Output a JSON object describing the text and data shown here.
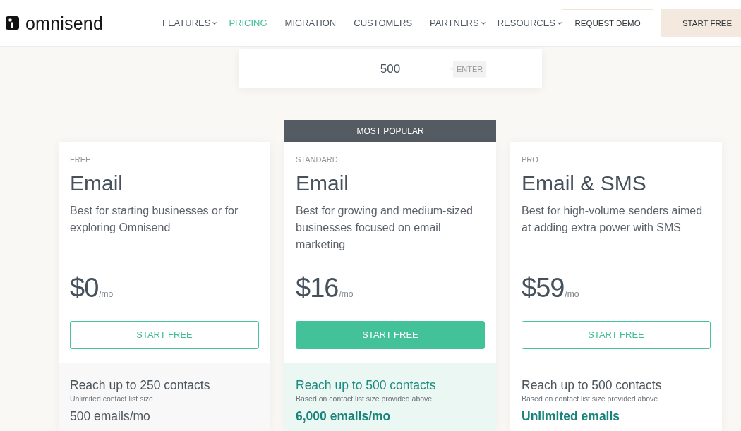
{
  "header": {
    "logo": {
      "text": "omnisend"
    },
    "nav": [
      {
        "label": "FEATURES",
        "selected": false,
        "has_menu": true
      },
      {
        "label": "PRICING",
        "selected": true,
        "has_menu": false
      },
      {
        "label": "MIGRATION",
        "selected": false,
        "has_menu": false
      },
      {
        "label": "CUSTOMERS",
        "selected": false,
        "has_menu": false
      },
      {
        "label": "PARTNERS",
        "selected": false,
        "has_menu": true
      },
      {
        "label": "RESOURCES",
        "selected": false,
        "has_menu": true
      }
    ],
    "buttons": [
      {
        "label": "REQUEST DEMO",
        "kind": "outline"
      },
      {
        "label": "START FREE",
        "kind": "filled"
      }
    ]
  },
  "contacts_input": {
    "value": "500",
    "button": "ENTER"
  },
  "plans": [
    {
      "kind": "free",
      "tier": "FREE",
      "title": "Email",
      "description": "Best for starting businesses or for exploring Omnisend",
      "price": "$0",
      "period": "/mo",
      "button": "START FREE",
      "contacts": "Reach up to 250 contacts",
      "contacts_note": "Unlimited contact list size",
      "emails": "500 emails/mo"
    },
    {
      "kind": "standard",
      "badge": "MOST POPULAR",
      "tier": "STANDARD",
      "title": "Email",
      "description": "Best for growing and medium-sized businesses focused on email marketing",
      "price": "$16",
      "period": "/mo",
      "button": "START FREE",
      "contacts": "Reach up to 500 contacts",
      "contacts_note": "Based on contact list size provided above",
      "emails": "6,000 emails/mo"
    },
    {
      "kind": "pro",
      "tier": "PRO",
      "title": "Email & SMS",
      "description": "Best for high-volume senders aimed at adding extra power with SMS",
      "price": "$59",
      "period": "/mo",
      "button": "START FREE",
      "contacts": "Reach up to 500 contacts",
      "contacts_note": "Based on contact list size provided above",
      "emails": "Unlimited emails"
    }
  ]
}
